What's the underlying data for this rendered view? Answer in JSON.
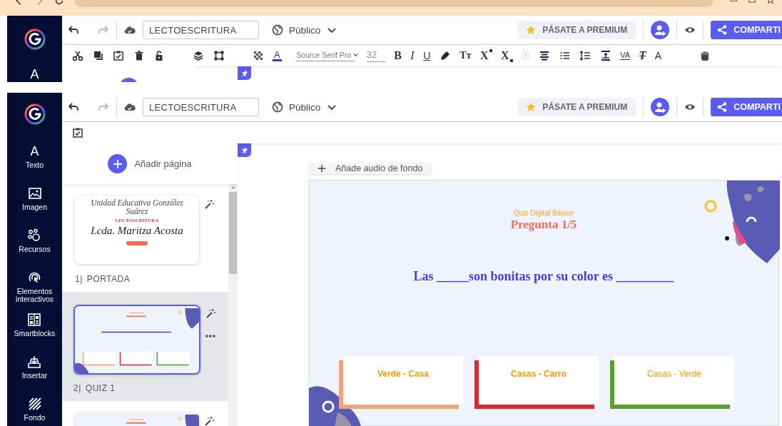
{
  "editors": [
    {
      "kind": "format",
      "title": "LECTOESCRITURA",
      "visibility": "Público",
      "premium": "PÁSATE A PREMIUM",
      "share": "COMPARTI",
      "sidebar": [
        {
          "kind": "text",
          "glyph": "A"
        }
      ],
      "font": "Source Serif Pro",
      "font_size": "32",
      "format_glyphs": [
        "A",
        "B",
        "I",
        "U",
        "Tт",
        "X",
        "X",
        "A",
        "VA",
        "T",
        "A"
      ]
    },
    {
      "kind": "pages",
      "title": "LECTOESCRITURA",
      "visibility": "Público",
      "premium": "PÁSATE A PREMIUM",
      "share": "COMPARTI",
      "sidebar": [
        {
          "kind": "text",
          "glyph": "A",
          "label": "Texto"
        },
        {
          "kind": "image",
          "label": "Imagen"
        },
        {
          "kind": "resources",
          "label": "Recursos"
        },
        {
          "kind": "interactive",
          "label": "Elementos interactivos"
        },
        {
          "kind": "smartblocks",
          "label": "Smartblocks"
        },
        {
          "kind": "insert",
          "label": "Insertar"
        },
        {
          "kind": "background",
          "label": "Fondo"
        }
      ],
      "add_page": "Añadir página",
      "pages": [
        {
          "kind": "cover",
          "number": "1|",
          "name": "PORTADA",
          "selected": false,
          "thumbnail": {
            "school": "Unidad Educativa González Suárez",
            "subject": "LECTOSCRITURA",
            "teacher": "Lcda. Maritza Acosta"
          }
        },
        {
          "kind": "quiz",
          "number": "2|",
          "name": "QUIZ 1",
          "selected": true
        },
        {
          "kind": "quiz",
          "selected": false
        }
      ],
      "audio_button": "Añade audio de fondo",
      "slide": {
        "subtitle": "Quiz Digital Básico",
        "title": "Pregunta 1/5",
        "question": "Las _____son bonitas por su color es _________",
        "answers": [
          {
            "text": "Verde - Casa",
            "color": "#f4a276",
            "bold": true
          },
          {
            "text": "Casas - Carro",
            "color": "#e6262e",
            "bold": true
          },
          {
            "text": "Casas - Verde",
            "color": "#5e9e2b",
            "bold": false
          }
        ]
      }
    }
  ]
}
